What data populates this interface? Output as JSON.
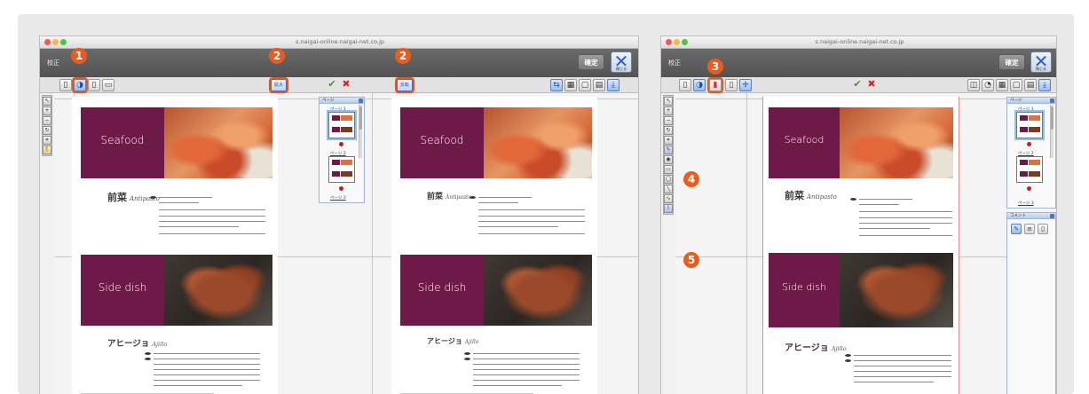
{
  "left_window": {
    "url": " s.naigai-online.naigai-net.co.jp",
    "header_title": "校正",
    "confirm_label": "確定",
    "close_label": "閉じる",
    "toolbar_buttons": {
      "text_a": "拡大",
      "text_b": "反転"
    }
  },
  "right_window": {
    "url": " s.naigai-online.naigai-net.co.jp",
    "header_title": "校正",
    "confirm_label": "確定",
    "close_label": "閉じる",
    "comment_panel_title": "コメント"
  },
  "menu_page": {
    "seafood_label": "Seafood",
    "side_dish_label": "Side dish",
    "appetizer_heading": "前菜",
    "appetizer_sub": "Antipasto",
    "ajillo_heading": "アヒージョ",
    "ajillo_sub": "Ajillo"
  },
  "page_panel": {
    "title": "ページ",
    "thumb_label_1": "ページ 1",
    "thumb_label_2": "ページ 2",
    "thumb_label_3": "ページ 3"
  },
  "badges": {
    "b1": "1",
    "b2a": "2",
    "b2b": "2",
    "b3": "3",
    "b4": "4",
    "b5": "5"
  },
  "colors": {
    "accent_orange": "#ea5b1f",
    "menu_purple": "#6e1a48",
    "header_gray": "#5e5e5e"
  },
  "icons": {
    "confirm": "check-icon",
    "reject": "cross-icon",
    "close": "close-x-icon"
  }
}
